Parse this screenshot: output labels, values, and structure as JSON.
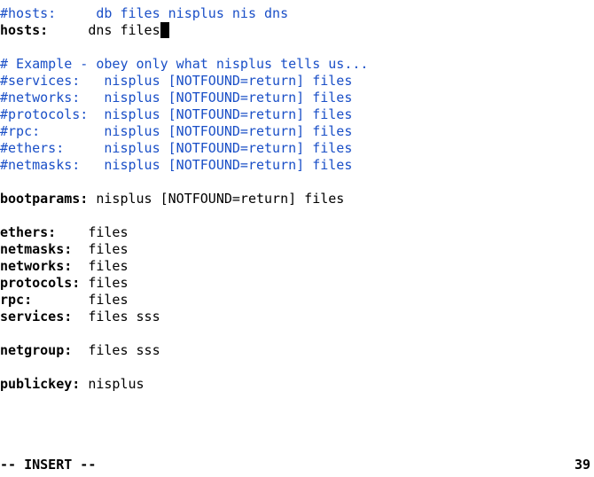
{
  "lines": [
    {
      "type": "comment",
      "text": "#hosts:     db files nisplus nis dns"
    },
    {
      "type": "entry",
      "key": "hosts:     ",
      "value": "dns files",
      "cursor": true
    },
    {
      "type": "blank"
    },
    {
      "type": "comment",
      "text": "# Example - obey only what nisplus tells us..."
    },
    {
      "type": "comment",
      "text": "#services:   nisplus [NOTFOUND=return] files"
    },
    {
      "type": "comment",
      "text": "#networks:   nisplus [NOTFOUND=return] files"
    },
    {
      "type": "comment",
      "text": "#protocols:  nisplus [NOTFOUND=return] files"
    },
    {
      "type": "comment",
      "text": "#rpc:        nisplus [NOTFOUND=return] files"
    },
    {
      "type": "comment",
      "text": "#ethers:     nisplus [NOTFOUND=return] files"
    },
    {
      "type": "comment",
      "text": "#netmasks:   nisplus [NOTFOUND=return] files"
    },
    {
      "type": "blank"
    },
    {
      "type": "entry",
      "key": "bootparams: ",
      "value": "nisplus [NOTFOUND=return] files"
    },
    {
      "type": "blank"
    },
    {
      "type": "entry",
      "key": "ethers:    ",
      "value": "files"
    },
    {
      "type": "entry",
      "key": "netmasks:  ",
      "value": "files"
    },
    {
      "type": "entry",
      "key": "networks:  ",
      "value": "files"
    },
    {
      "type": "entry",
      "key": "protocols: ",
      "value": "files"
    },
    {
      "type": "entry",
      "key": "rpc:       ",
      "value": "files"
    },
    {
      "type": "entry",
      "key": "services:  ",
      "value": "files sss"
    },
    {
      "type": "blank"
    },
    {
      "type": "entry",
      "key": "netgroup:  ",
      "value": "files sss"
    },
    {
      "type": "blank"
    },
    {
      "type": "entry",
      "key": "publickey: ",
      "value": "nisplus"
    },
    {
      "type": "blank"
    }
  ],
  "status": {
    "mode": "-- INSERT --",
    "pos": "39"
  }
}
